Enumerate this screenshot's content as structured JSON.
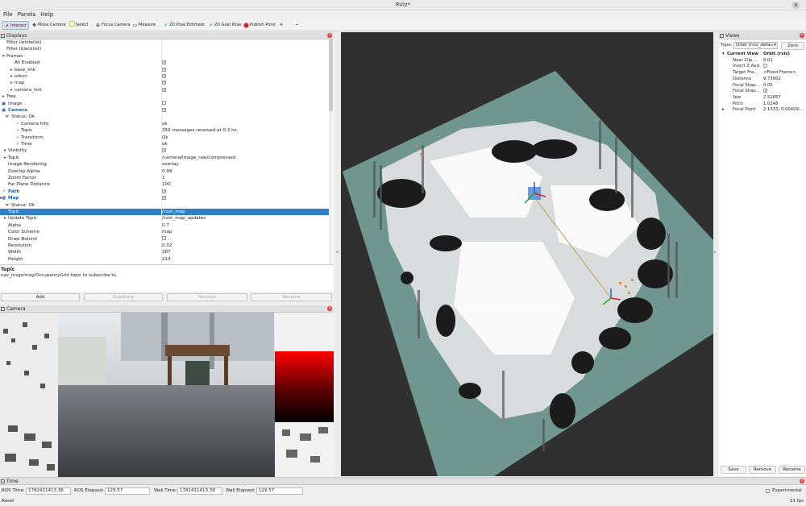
{
  "window": {
    "title": "RViz*"
  },
  "menu": [
    "File",
    "Panels",
    "Help"
  ],
  "toolbar": {
    "interact": "Interact",
    "move_camera": "Move Camera",
    "select": "Select",
    "focus_camera": "Focus Camera",
    "measure": "Measure",
    "pose_estimate": "2D Pose Estimate",
    "goal_pose": "2D Goal Pose",
    "publish_point": "Publish Point"
  },
  "displays": {
    "title": "Displays",
    "rows": [
      {
        "name": "Filter (whitelist)",
        "value": ""
      },
      {
        "name": "Filter (blacklist)",
        "value": ""
      },
      {
        "name": "Frames",
        "value": ""
      },
      {
        "name": "All Enabled",
        "value": ""
      },
      {
        "name": "base_link",
        "value": ""
      },
      {
        "name": "odom",
        "value": ""
      },
      {
        "name": "map",
        "value": ""
      },
      {
        "name": "camera_link",
        "value": ""
      },
      {
        "name": "Tree",
        "value": ""
      },
      {
        "name": "image",
        "value": ""
      },
      {
        "name": "Camera",
        "value": ""
      },
      {
        "name": "Status: Ok",
        "value": ""
      },
      {
        "name": "Camera Info",
        "value": "ok"
      },
      {
        "name": "Topic",
        "value": "356 messages received at 0.3 hz."
      },
      {
        "name": "Transform",
        "value": "Ok"
      },
      {
        "name": "Time",
        "value": "ok"
      },
      {
        "name": "Visibility",
        "value": ""
      },
      {
        "name": "Topic",
        "value": "/camera/image_raw/compressed"
      },
      {
        "name": "Image Rendering",
        "value": "overlay"
      },
      {
        "name": "Overlay Alpha",
        "value": "0.99"
      },
      {
        "name": "Zoom Factor",
        "value": "1"
      },
      {
        "name": "Far Plane Distance",
        "value": "100"
      },
      {
        "name": "Path",
        "value": ""
      },
      {
        "name": "Map",
        "value": ""
      },
      {
        "name": "Status: Ok",
        "value": ""
      },
      {
        "name": "Topic",
        "value": "/cost_map"
      },
      {
        "name": "Update Topic",
        "value": "/cost_map_updates"
      },
      {
        "name": "Alpha",
        "value": "0.7"
      },
      {
        "name": "Color Scheme",
        "value": "map"
      },
      {
        "name": "Draw Behind",
        "value": ""
      },
      {
        "name": "Resolution",
        "value": "0.02"
      },
      {
        "name": "Width",
        "value": "287"
      },
      {
        "name": "Height",
        "value": "213"
      }
    ],
    "desc_title": "Topic",
    "desc_text": "nav_msgs/msg/OccupancyGrid topic to subscribe to.",
    "buttons": {
      "add": "Add",
      "duplicate": "Duplicate",
      "remove": "Remove",
      "rename": "Rename"
    }
  },
  "camera_panel": {
    "title": "Camera"
  },
  "views": {
    "title": "Views",
    "type_label": "Type:",
    "type_value": "Orbit (rviz_defau",
    "zero": "Zero",
    "rows": [
      {
        "name": "Current View",
        "value": "Orbit (rviz)"
      },
      {
        "name": "Near Clip ...",
        "value": "0.01"
      },
      {
        "name": "Invert Z Axis",
        "value": ""
      },
      {
        "name": "Target Fra...",
        "value": "<Fixed Frame>"
      },
      {
        "name": "Distance",
        "value": "9.73002"
      },
      {
        "name": "Focal Shap...",
        "value": "0.05"
      },
      {
        "name": "Focal Shap...",
        "value": ""
      },
      {
        "name": "Yaw",
        "value": "2.52857"
      },
      {
        "name": "Pitch",
        "value": "1.0248"
      },
      {
        "name": "Focal Point",
        "value": "2.1333; 0.00429;..."
      }
    ],
    "buttons": {
      "save": "Save",
      "remove": "Remove",
      "rename": "Rename"
    }
  },
  "time": {
    "title": "Time",
    "ros_time_label": "ROS Time:",
    "ros_time": "1782411413.36",
    "ros_elapsed_label": "ROS Elapsed:",
    "ros_elapsed": "129.57",
    "wall_time_label": "Wall Time:",
    "wall_time": "1782411413.39",
    "wall_elapsed_label": "Wall Elapsed:",
    "wall_elapsed": "129.57",
    "experimental": "Experimental",
    "reset": "Reset",
    "fps": "31 fps"
  },
  "colors": {
    "selection": "#2f7fc6",
    "ok_green": "#2a9a2a",
    "close_red": "#dd3333",
    "map_teal": "#6f9790"
  }
}
